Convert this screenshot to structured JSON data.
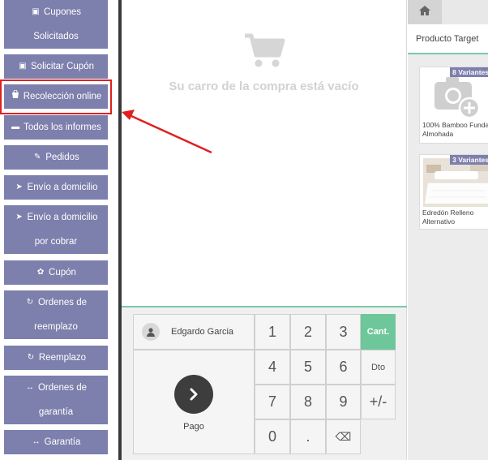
{
  "sidebar": {
    "items": [
      {
        "icon": "coupon-icon",
        "glyph": "▣",
        "line1": "Cupones",
        "line2": "Solicitados"
      },
      {
        "icon": "coupon-icon",
        "glyph": "▣",
        "line1": "Solicitar Cupón",
        "line2": ""
      },
      {
        "icon": "shopping-bag-icon",
        "glyph": "🛍",
        "line1": "Recolección online",
        "line2": ""
      },
      {
        "icon": "report-icon",
        "glyph": "▬",
        "line1": "Todos los informes",
        "line2": ""
      },
      {
        "icon": "paperclip-icon",
        "glyph": "✎",
        "line1": "Pedidos",
        "line2": ""
      },
      {
        "icon": "send-icon",
        "glyph": "➤",
        "line1": "Envío a domicilio",
        "line2": ""
      },
      {
        "icon": "send-icon",
        "glyph": "➤",
        "line1": "Envío a domicilio",
        "line2": "por cobrar"
      },
      {
        "icon": "gift-icon",
        "glyph": "✿",
        "line1": "Cupón",
        "line2": ""
      },
      {
        "icon": "refresh-icon",
        "glyph": "↻",
        "line1": "Ordenes de",
        "line2": "reemplazo"
      },
      {
        "icon": "refresh-icon",
        "glyph": "↻",
        "line1": "Reemplazo",
        "line2": ""
      },
      {
        "icon": "arrows-horizontal-icon",
        "glyph": "↔",
        "line1": "Ordenes de",
        "line2": "garantía"
      },
      {
        "icon": "arrows-horizontal-icon",
        "glyph": "↔",
        "line1": "Garantía",
        "line2": ""
      }
    ]
  },
  "cart": {
    "empty_message": "Su carro de la compra está vacío"
  },
  "pad": {
    "customer_name": "Edgardo Garcia",
    "pay_label": "Pago",
    "keys": [
      "1",
      "2",
      "3",
      "Cant.",
      "4",
      "5",
      "6",
      "Dto",
      "7",
      "8",
      "9",
      "+/-",
      "0",
      ".",
      "⌫"
    ]
  },
  "right_panel": {
    "tab_label": "Producto Target",
    "products": [
      {
        "name": "100% Bamboo Funda Almohada",
        "badge": "8 Variantes"
      },
      {
        "name": "Edredón Relleno Alternativo",
        "badge": "3 Variantes"
      }
    ]
  },
  "colors": {
    "sidebar_button": "#7d7fac",
    "accent_green": "#6ec79a",
    "highlight_red": "#e02020"
  }
}
